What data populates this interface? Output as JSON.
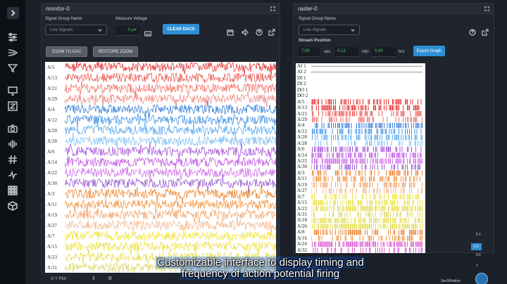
{
  "monitor": {
    "title": "monitor-0",
    "signal_group_label": "Signal Group Name",
    "signal_group_value": "Live Signals",
    "measure_voltage_label": "Measure Voltage",
    "measure_voltage_value": "0 µV",
    "clear_dacs": "CLEAR DACS",
    "zoom_to_dac": "ZOOM TO DAC",
    "restore_zoom": "RESTORE ZOOM",
    "channels": [
      "A/5",
      "A/13",
      "A/21",
      "A/29",
      "A/4",
      "A/12",
      "A/20",
      "A/28",
      "A/6",
      "A/14",
      "A/22",
      "A/30",
      "A/3",
      "A/11",
      "A/19",
      "A/27",
      "A/7",
      "A/15",
      "A/23",
      "A/31"
    ],
    "channel_colors": [
      "#e31b1b",
      "#e8453c",
      "#ee6257",
      "#f07d76",
      "#1f6fd6",
      "#2a86e6",
      "#4aa1ee",
      "#6fb8f2",
      "#9c3fd6",
      "#b842e0",
      "#c95fe6",
      "#8a47c9",
      "#e8761a",
      "#ef8a2c",
      "#f09a5a",
      "#f2ad7e",
      "#f0e21d",
      "#e9dd2a",
      "#e4d93c",
      "#d8d255"
    ]
  },
  "raster": {
    "title": "raster-0",
    "signal_group_label": "Signal Group Name",
    "signal_group_value": "Live Signals",
    "stream_position_label": "Stream Position",
    "sec_value": "7.00",
    "sec_unit": "sec",
    "min_value": "0.12",
    "min_unit": "min",
    "hrs_value": "0.00",
    "hrs_unit": "hrs",
    "export_graph": "Export Graph",
    "rows": [
      "AI 1",
      "AI 2",
      "DI 1",
      "DI 2",
      "DO 1",
      "DO 2",
      "A/5",
      "A/13",
      "A/21",
      "A/29",
      "A/4",
      "A/12",
      "A/20",
      "A/28",
      "A/6",
      "A/14",
      "A/22",
      "A/30",
      "A/3",
      "A/11",
      "A/19",
      "A/27",
      "A/7",
      "A/15",
      "A/23",
      "A/31",
      "A/18",
      "A/26",
      "A/8",
      "A/16",
      "A/24",
      "A/32"
    ],
    "row_colors": [
      "#555",
      "#555",
      "#555",
      "#555",
      "#555",
      "#555",
      "#e31b1b",
      "#e31b1b",
      "#e8453c",
      "#ee6257",
      "#1f6fd6",
      "#2a86e6",
      "#4aa1ee",
      "#6fb8f2",
      "#9c3fd6",
      "#b842e0",
      "#c95fe6",
      "#8a47c9",
      "#e8761a",
      "#ef8a2c",
      "#f09a5a",
      "#f2ad7e",
      "#f0e21d",
      "#e9dd2a",
      "#e4d93c",
      "#d8d255",
      "#e4d93c",
      "#e4d93c",
      "#e8761a",
      "#ef8a2c",
      "#d548c8",
      "#d548c8"
    ]
  },
  "sec_window": {
    "label": "Sec/Window",
    "steps": [
      "0.1",
      "0.2",
      "0.5",
      "1"
    ],
    "selected": "0.2"
  },
  "bottom": {
    "xy_plot": "X-Y Plot"
  },
  "caption": {
    "line1": "Customizable interface to display timing and",
    "line2": "frequency of action potential firing"
  },
  "icons": [
    "chevron-right-icon",
    "sliders-icon",
    "signal-icon",
    "filter-icon",
    "monitor-icon",
    "z-icon",
    "camera-icon",
    "waveform-icon",
    "hash-icon",
    "pulse-icon",
    "grid-icon",
    "cube-icon",
    "calendar-icon",
    "speaker-icon",
    "help-icon",
    "external-link-icon",
    "expand-icon"
  ]
}
